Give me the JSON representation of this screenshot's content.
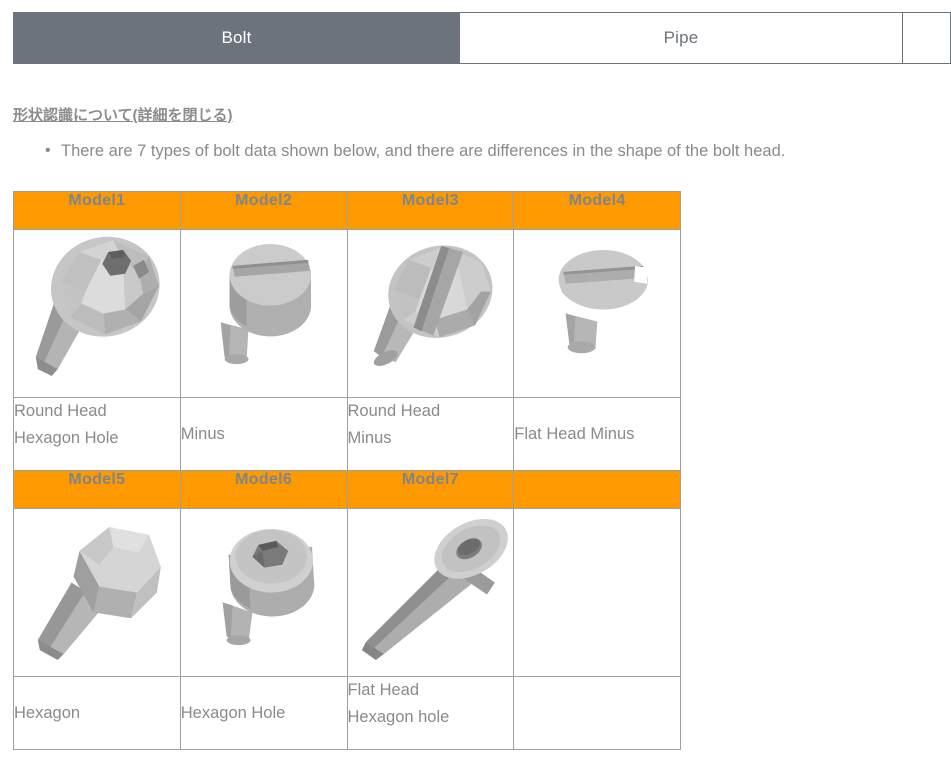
{
  "tabs": [
    {
      "label": "Bolt",
      "active": true
    },
    {
      "label": "Pipe",
      "active": false
    },
    {
      "label": "",
      "active": false
    }
  ],
  "section": {
    "heading": "形状認識について(詳細を閉じる)"
  },
  "notes": [
    "There are 7 types of bolt data shown below, and there are differences in the shape of the bolt head."
  ],
  "colors": {
    "header_orange": "#FF9900",
    "tab_active_bg": "#6C737C",
    "text_gray": "#8A8A8A",
    "border_gray": "#9AA0A6"
  },
  "table": {
    "rows": [
      {
        "headers": [
          "Model1",
          "Model2",
          "Model3",
          "Model4"
        ],
        "images": [
          "bolt-round-head-hexagon-hole",
          "bolt-minus",
          "bolt-round-head-minus",
          "bolt-flat-head-minus"
        ],
        "labels": [
          [
            "Round Head",
            "Hexagon Hole"
          ],
          [
            "Minus"
          ],
          [
            "Round Head",
            "Minus"
          ],
          [
            "Flat Head Minus"
          ]
        ]
      },
      {
        "headers": [
          "Model5",
          "Model6",
          "Model7",
          ""
        ],
        "images": [
          "bolt-hexagon",
          "bolt-hexagon-hole",
          "bolt-flat-head-hexagon-hole",
          ""
        ],
        "labels": [
          [
            "Hexagon"
          ],
          [
            "Hexagon Hole"
          ],
          [
            "Flat Head",
            "Hexagon hole"
          ],
          [
            ""
          ]
        ]
      }
    ]
  }
}
